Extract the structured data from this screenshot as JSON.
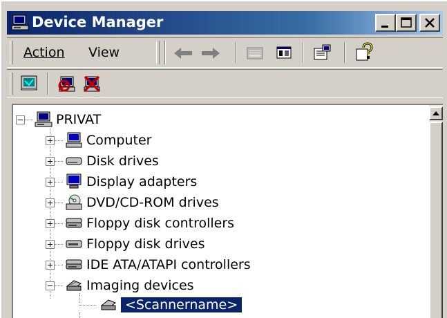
{
  "window": {
    "title": "Device Manager",
    "title_color": "#0a246a",
    "controls": {
      "minimize": "minimize-icon",
      "maximize": "maximize-icon",
      "close": "close-icon"
    }
  },
  "menu": {
    "action_label": "Action",
    "view_label": "View"
  },
  "toolbar": {
    "icons": [
      "back-arrow-icon",
      "forward-arrow-icon",
      "up-folder-icon",
      "show-hide-tree-icon",
      "properties-icon",
      "help-icon"
    ]
  },
  "toolbar2": {
    "icons": [
      "scan-hardware-icon",
      "disable-device-icon",
      "uninstall-device-icon"
    ]
  },
  "tree": {
    "root": "PRIVAT",
    "items": [
      {
        "label": "Computer",
        "icon": "computer-icon"
      },
      {
        "label": "Disk drives",
        "icon": "disk-drive-icon"
      },
      {
        "label": "Display adapters",
        "icon": "display-adapter-icon"
      },
      {
        "label": "DVD/CD-ROM drives",
        "icon": "dvd-drive-icon"
      },
      {
        "label": "Floppy disk controllers",
        "icon": "floppy-controller-icon"
      },
      {
        "label": "Floppy disk drives",
        "icon": "floppy-drive-icon"
      },
      {
        "label": "IDE ATA/ATAPI controllers",
        "icon": "ide-controller-icon"
      },
      {
        "label": "Imaging devices",
        "icon": "imaging-device-icon"
      }
    ],
    "child": {
      "label": "<Scannername>",
      "icon": "scanner-icon"
    },
    "selection_color": "#0a246a"
  }
}
